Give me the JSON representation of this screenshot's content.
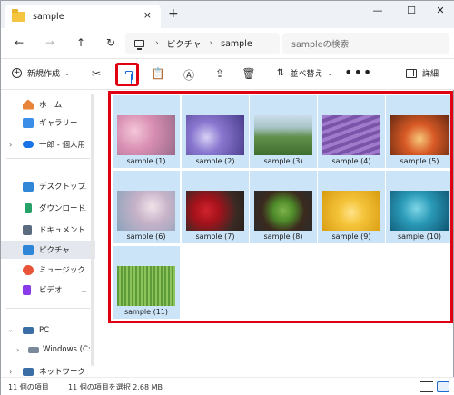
{
  "window": {
    "tab_title": "sample",
    "close_tab": "×",
    "new_tab": "+",
    "minimize": "—",
    "maximize": "☐",
    "close": "✕"
  },
  "address": {
    "back": "←",
    "forward": "→",
    "up": "↑",
    "refresh": "↻",
    "path": [
      "ピクチャ",
      "sample"
    ],
    "separator": "›",
    "search_placeholder": "sampleの検索"
  },
  "toolbar": {
    "new_label": "新規作成",
    "sort_label": "並べ替え",
    "more": "•••",
    "details_label": "詳細",
    "caret": "⌄"
  },
  "sidebar": {
    "items": [
      {
        "label": "ホーム",
        "icon": "home-icon",
        "color": "#e8833a"
      },
      {
        "label": "ギャラリー",
        "icon": "gallery-icon",
        "color": "#3a8ee8"
      },
      {
        "label": "一郎 - 個人用",
        "icon": "onedrive-icon",
        "color": "#1a73e8"
      },
      {
        "label": "デスクトップ",
        "icon": "desktop-icon",
        "color": "#2f86d6",
        "pin": "📌"
      },
      {
        "label": "ダウンロード",
        "icon": "download-icon",
        "color": "#26a269",
        "pin": "📌"
      },
      {
        "label": "ドキュメント",
        "icon": "documents-icon",
        "color": "#5b6b80",
        "pin": "📌"
      },
      {
        "label": "ピクチャ",
        "icon": "pictures-icon",
        "color": "#2f86d6",
        "pin": "📌"
      },
      {
        "label": "ミュージック",
        "icon": "music-icon",
        "color": "#e8533a",
        "pin": "📌"
      },
      {
        "label": "ビデオ",
        "icon": "videos-icon",
        "color": "#8a3ae8",
        "pin": "📌"
      },
      {
        "label": "PC",
        "icon": "pc-icon",
        "color": "#3a6ea5"
      },
      {
        "label": "Windows (C:)",
        "icon": "drive-icon",
        "color": "#7a8a9a"
      },
      {
        "label": "ネットワーク",
        "icon": "network-icon",
        "color": "#3a6ea5"
      }
    ]
  },
  "files": [
    {
      "name": "sample (1)"
    },
    {
      "name": "sample (2)"
    },
    {
      "name": "sample (3)"
    },
    {
      "name": "sample (4)"
    },
    {
      "name": "sample (5)"
    },
    {
      "name": "sample (6)"
    },
    {
      "name": "sample (7)"
    },
    {
      "name": "sample (8)"
    },
    {
      "name": "sample (9)"
    },
    {
      "name": "sample (10)"
    },
    {
      "name": "sample (11)"
    }
  ],
  "status": {
    "item_count": "11 個の項目",
    "selection": "11 個の項目を選択  2.68 MB"
  },
  "colors": {
    "selection_bg": "#cce4f7",
    "highlight_border": "#e00012",
    "accent": "#1a6ad6"
  }
}
